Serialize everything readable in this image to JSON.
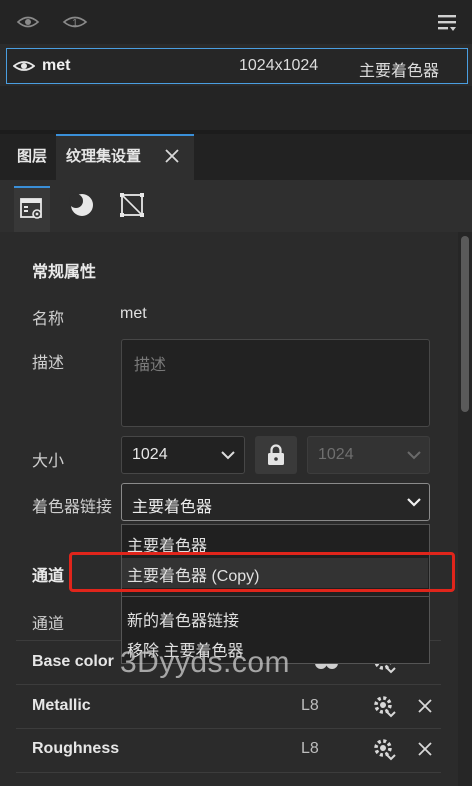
{
  "texture_set_list": {
    "name": "met",
    "resolution": "1024x1024",
    "shader": "主要着色器"
  },
  "tabs": {
    "layers": "图层",
    "texture_set_settings": "纹理集设置"
  },
  "general": {
    "heading": "常规属性",
    "name_label": "名称",
    "name_value": "met",
    "description_label": "描述",
    "description_placeholder": "描述",
    "size_label": "大小",
    "size_width": "1024",
    "size_height": "1024",
    "shader_link_label": "着色器链接",
    "shader_link_value": "主要着色器"
  },
  "shader_menu": {
    "items": [
      "主要着色器",
      "主要着色器 (Copy)"
    ],
    "actions": [
      "新的着色器链接",
      "移除 主要着色器"
    ]
  },
  "channels": {
    "heading": "通道",
    "sub_label": "通道",
    "rows": [
      {
        "name": "Base color",
        "format": ""
      },
      {
        "name": "Metallic",
        "format": "L8"
      },
      {
        "name": "Roughness",
        "format": "L8"
      }
    ]
  },
  "watermark": "3Dyyds.com",
  "colors": {
    "accent": "#3a8fd8",
    "selection_border": "#4a9ee0",
    "highlight_box": "#e0251b"
  }
}
